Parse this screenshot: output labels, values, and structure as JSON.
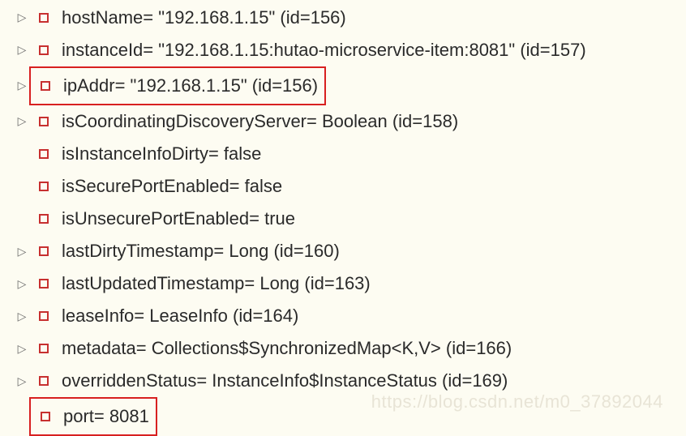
{
  "rows": [
    {
      "expandable": true,
      "highlighted": false,
      "text": "hostName= \"192.168.1.15\" (id=156)"
    },
    {
      "expandable": true,
      "highlighted": false,
      "text": "instanceId= \"192.168.1.15:hutao-microservice-item:8081\" (id=157)"
    },
    {
      "expandable": true,
      "highlighted": true,
      "text": "ipAddr= \"192.168.1.15\" (id=156)"
    },
    {
      "expandable": true,
      "highlighted": false,
      "text": "isCoordinatingDiscoveryServer= Boolean  (id=158)"
    },
    {
      "expandable": false,
      "highlighted": false,
      "text": "isInstanceInfoDirty= false"
    },
    {
      "expandable": false,
      "highlighted": false,
      "text": "isSecurePortEnabled= false"
    },
    {
      "expandable": false,
      "highlighted": false,
      "text": "isUnsecurePortEnabled= true"
    },
    {
      "expandable": true,
      "highlighted": false,
      "text": "lastDirtyTimestamp= Long  (id=160)"
    },
    {
      "expandable": true,
      "highlighted": false,
      "text": "lastUpdatedTimestamp= Long  (id=163)"
    },
    {
      "expandable": true,
      "highlighted": false,
      "text": "leaseInfo= LeaseInfo  (id=164)"
    },
    {
      "expandable": true,
      "highlighted": false,
      "text": "metadata= Collections$SynchronizedMap<K,V>  (id=166)"
    },
    {
      "expandable": true,
      "highlighted": false,
      "text": "overriddenStatus= InstanceInfo$InstanceStatus  (id=169)"
    },
    {
      "expandable": false,
      "highlighted": true,
      "text": "port= 8081"
    }
  ],
  "watermark": "https://blog.csdn.net/m0_37892044"
}
